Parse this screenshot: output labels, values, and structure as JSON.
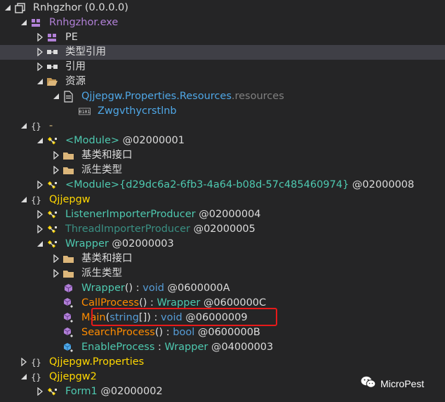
{
  "tree": [
    {
      "depth": 0,
      "expander": "open",
      "icon": "assembly",
      "parts": [
        {
          "t": "Rnhgzhor (0.0.0.0)",
          "c": "c-white"
        }
      ]
    },
    {
      "depth": 1,
      "expander": "open",
      "icon": "module",
      "parts": [
        {
          "t": "Rnhgzhor.exe",
          "c": "c-mod"
        }
      ]
    },
    {
      "depth": 2,
      "expander": "closed",
      "icon": "module",
      "parts": [
        {
          "t": "PE",
          "c": "c-white"
        }
      ]
    },
    {
      "depth": 2,
      "expander": "closed",
      "icon": "references",
      "selected": true,
      "parts": [
        {
          "t": "类型引用",
          "c": "c-white"
        }
      ]
    },
    {
      "depth": 2,
      "expander": "closed",
      "icon": "references",
      "parts": [
        {
          "t": "引用",
          "c": "c-white"
        }
      ]
    },
    {
      "depth": 2,
      "expander": "open",
      "icon": "folder-open",
      "parts": [
        {
          "t": "资源",
          "c": "c-white"
        }
      ]
    },
    {
      "depth": 3,
      "expander": "open",
      "icon": "resource-file",
      "parts": [
        {
          "t": "Qjjepgw.Properties.Resources",
          "c": "c-res"
        },
        {
          "t": ".resources",
          "c": "c-ext"
        }
      ]
    },
    {
      "depth": 4,
      "expander": "none",
      "icon": "binary",
      "parts": [
        {
          "t": "Zwgvthycrstlnb",
          "c": "c-res"
        }
      ]
    },
    {
      "depth": 1,
      "expander": "open",
      "icon": "namespace",
      "parts": [
        {
          "t": "-",
          "c": "c-ns"
        }
      ]
    },
    {
      "depth": 2,
      "expander": "open",
      "icon": "class",
      "parts": [
        {
          "t": "<Module>",
          "c": "c-type"
        },
        {
          "t": " @02000001",
          "c": "c-white"
        }
      ]
    },
    {
      "depth": 3,
      "expander": "closed",
      "icon": "folder",
      "parts": [
        {
          "t": "基类和接口",
          "c": "c-white"
        }
      ]
    },
    {
      "depth": 3,
      "expander": "closed",
      "icon": "folder",
      "parts": [
        {
          "t": "派生类型",
          "c": "c-white"
        }
      ]
    },
    {
      "depth": 2,
      "expander": "closed",
      "icon": "class",
      "parts": [
        {
          "t": "<Module>{d29dc6a2-6fb3-4a64-b08d-57c485460974}",
          "c": "c-type"
        },
        {
          "t": " @02000008",
          "c": "c-white"
        }
      ]
    },
    {
      "depth": 1,
      "expander": "open",
      "icon": "namespace",
      "parts": [
        {
          "t": "Qjjepgw",
          "c": "c-ns-bright"
        }
      ]
    },
    {
      "depth": 2,
      "expander": "closed",
      "icon": "class",
      "parts": [
        {
          "t": "ListenerImporterProducer",
          "c": "c-type"
        },
        {
          "t": " @02000004",
          "c": "c-white"
        }
      ]
    },
    {
      "depth": 2,
      "expander": "closed",
      "icon": "class",
      "parts": [
        {
          "t": "ThreadImporterProducer",
          "c": "c-type-dim"
        },
        {
          "t": " @02000005",
          "c": "c-white"
        }
      ]
    },
    {
      "depth": 2,
      "expander": "open",
      "icon": "class",
      "parts": [
        {
          "t": "Wrapper",
          "c": "c-type"
        },
        {
          "t": " @02000003",
          "c": "c-white"
        }
      ]
    },
    {
      "depth": 3,
      "expander": "closed",
      "icon": "folder",
      "parts": [
        {
          "t": "基类和接口",
          "c": "c-white"
        }
      ]
    },
    {
      "depth": 3,
      "expander": "closed",
      "icon": "folder",
      "parts": [
        {
          "t": "派生类型",
          "c": "c-white"
        }
      ]
    },
    {
      "depth": 3,
      "expander": "none",
      "icon": "method",
      "parts": [
        {
          "t": "Wrapper",
          "c": "c-type"
        },
        {
          "t": "() : ",
          "c": "c-punct"
        },
        {
          "t": "void",
          "c": "c-kw"
        },
        {
          "t": " @0600000A",
          "c": "c-white"
        }
      ]
    },
    {
      "depth": 3,
      "expander": "none",
      "icon": "method-private",
      "parts": [
        {
          "t": "CallProcess",
          "c": "c-method"
        },
        {
          "t": "() : ",
          "c": "c-punct"
        },
        {
          "t": "Wrapper",
          "c": "c-type"
        },
        {
          "t": " @0600000C",
          "c": "c-white"
        }
      ]
    },
    {
      "depth": 3,
      "expander": "none",
      "icon": "method-private",
      "parts": [
        {
          "t": "Main",
          "c": "c-method"
        },
        {
          "t": "(",
          "c": "c-punct"
        },
        {
          "t": "string",
          "c": "c-kw"
        },
        {
          "t": "[]) : ",
          "c": "c-punct"
        },
        {
          "t": "void",
          "c": "c-kw"
        },
        {
          "t": " @06000009",
          "c": "c-white"
        }
      ]
    },
    {
      "depth": 3,
      "expander": "none",
      "icon": "method-private",
      "parts": [
        {
          "t": "SearchProcess",
          "c": "c-method"
        },
        {
          "t": "() : ",
          "c": "c-punct"
        },
        {
          "t": "bool",
          "c": "c-kw"
        },
        {
          "t": " @0600000B",
          "c": "c-white"
        }
      ]
    },
    {
      "depth": 3,
      "expander": "none",
      "icon": "field",
      "parts": [
        {
          "t": "EnableProcess",
          "c": "c-type"
        },
        {
          "t": " : ",
          "c": "c-punct"
        },
        {
          "t": "Wrapper",
          "c": "c-type"
        },
        {
          "t": " @04000003",
          "c": "c-white"
        }
      ]
    },
    {
      "depth": 1,
      "expander": "closed",
      "icon": "namespace",
      "parts": [
        {
          "t": "Qjjepgw.Properties",
          "c": "c-ns-bright"
        }
      ]
    },
    {
      "depth": 1,
      "expander": "open",
      "icon": "namespace",
      "parts": [
        {
          "t": "Qjjepgw2",
          "c": "c-ns-bright"
        }
      ]
    },
    {
      "depth": 2,
      "expander": "closed",
      "icon": "class",
      "parts": [
        {
          "t": "Form1",
          "c": "c-type"
        },
        {
          "t": " @02000002",
          "c": "c-white"
        }
      ]
    }
  ],
  "watermark": {
    "text": "MicroPest",
    "icon": "wechat-icon"
  },
  "colors": {
    "selection": "#3f3f46",
    "highlight": "#e81a1a",
    "background": "#252526"
  }
}
